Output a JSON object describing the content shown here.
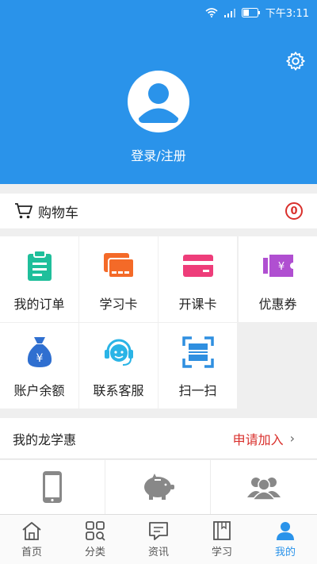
{
  "status_bar": {
    "time": "下午3:11"
  },
  "header": {
    "login_label": "登录/注册"
  },
  "cart": {
    "label": "购物车",
    "count": "0"
  },
  "grid": [
    {
      "label": "我的订单",
      "icon": "clipboard-icon",
      "color": "#1fbf9b"
    },
    {
      "label": "学习卡",
      "icon": "cards-icon",
      "color": "#f46a28"
    },
    {
      "label": "开课卡",
      "icon": "card-icon",
      "color": "#ee3d7a"
    },
    {
      "label": "优惠券",
      "icon": "coupon-icon",
      "color": "#b04fd1"
    },
    {
      "label": "账户余额",
      "icon": "money-bag-icon",
      "color": "#2f6fd0"
    },
    {
      "label": "联系客服",
      "icon": "headset-icon",
      "color": "#2ab4e6"
    },
    {
      "label": "扫一扫",
      "icon": "scan-icon",
      "color": "#2f8fe0"
    }
  ],
  "promo": {
    "title": "我的龙学惠",
    "action": "申请加入"
  },
  "tabs": [
    {
      "label": "首页",
      "icon": "home-icon"
    },
    {
      "label": "分类",
      "icon": "category-icon"
    },
    {
      "label": "资讯",
      "icon": "news-icon"
    },
    {
      "label": "学习",
      "icon": "book-icon"
    },
    {
      "label": "我的",
      "icon": "profile-icon",
      "active": true
    }
  ],
  "colors": {
    "primary": "#2a93ea",
    "alert": "#d9302c"
  }
}
